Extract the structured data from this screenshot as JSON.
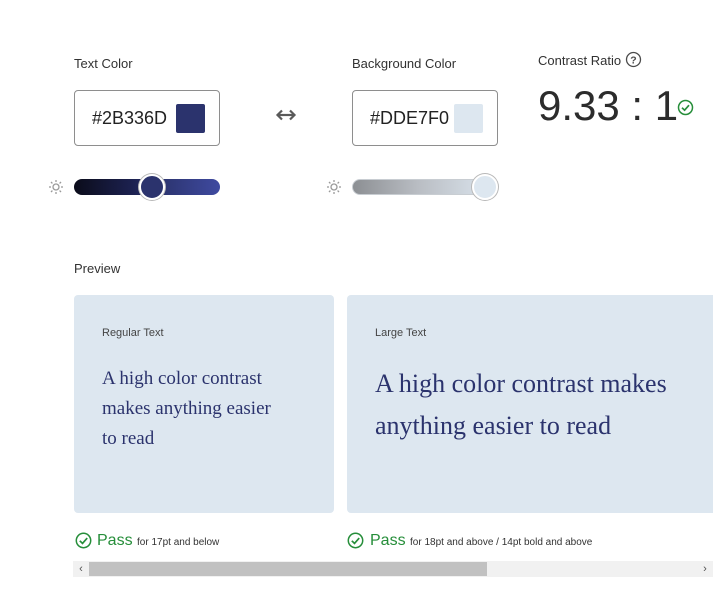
{
  "text_color": {
    "label": "Text Color",
    "hex": "#2B336D",
    "swatch": "#2B336D"
  },
  "background_color": {
    "label": "Background Color",
    "hex": "#DDE7F0",
    "swatch": "#DDE7F0"
  },
  "contrast": {
    "label": "Contrast Ratio",
    "help_icon": "question-circle-icon",
    "value": "9.33 : 1",
    "status_icon": "check-circle-icon"
  },
  "swap_icon": "swap-arrows-icon",
  "brightness_icon": "sun-icon",
  "sliders": {
    "text_brightness_percent": 54,
    "background_brightness_percent": 100
  },
  "preview": {
    "label": "Preview",
    "regular": {
      "title": "Regular Text",
      "sample_line1": "A high color contrast",
      "sample_line2": "makes anything easier",
      "sample_line3": "to read",
      "result": "Pass",
      "note": "for 17pt and below"
    },
    "large": {
      "title": "Large Text",
      "sample_line1": "A high color contrast makes",
      "sample_line2": "anything easier to read",
      "result": "Pass",
      "note": "for 18pt and above / 14pt bold and above"
    }
  },
  "scrollbar": {
    "left_arrow": "‹",
    "right_arrow": "›"
  },
  "colors": {
    "pass_green": "#268E3A",
    "preview_bg": "#DDE7F0",
    "text_sample": "#2B336D"
  }
}
